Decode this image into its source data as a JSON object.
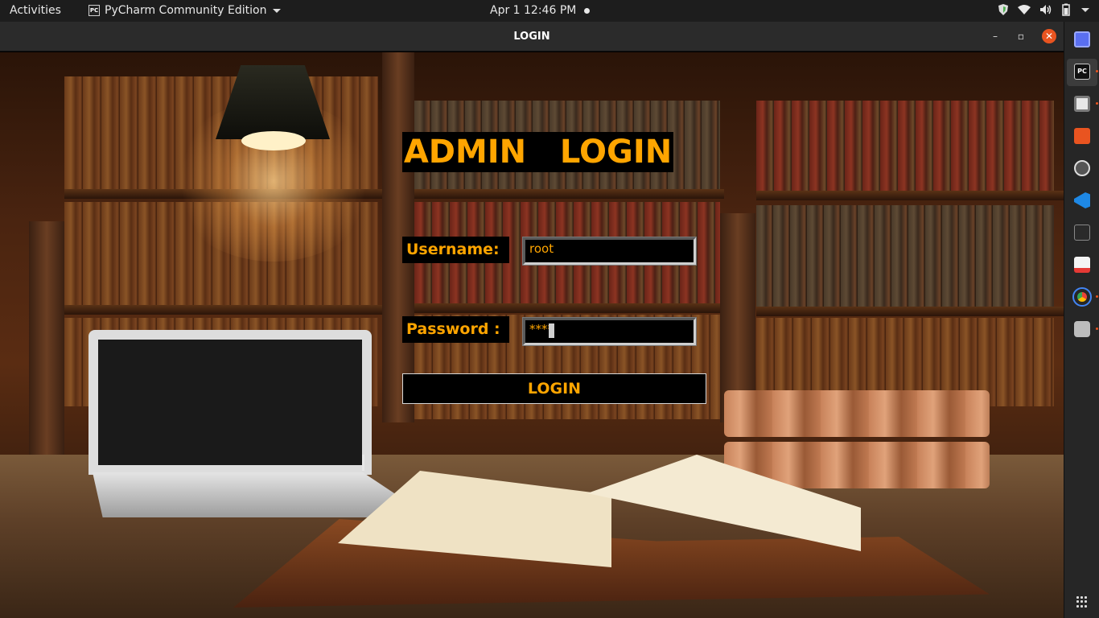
{
  "topbar": {
    "activities": "Activities",
    "app_name": "PyCharm Community Edition",
    "app_icon_text": "PC",
    "clock": "Apr 1  12:46 PM"
  },
  "window": {
    "title": "LOGIN",
    "minimize": "–",
    "maximize": "▫",
    "close": "✕"
  },
  "login": {
    "heading": "ADMIN   LOGIN",
    "username_label": "Username:",
    "username_value": "root",
    "password_label": "Password :",
    "password_value": "****",
    "button_label": "LOGIN"
  },
  "dock": {
    "icons": [
      "screenshot-icon",
      "pycharm-icon",
      "files-icon",
      "software-center-icon",
      "updater-icon",
      "vscode-icon",
      "terminal-icon",
      "document-viewer-icon",
      "chrome-icon",
      "disk-icon"
    ],
    "colors": {
      "accent": "#e95420",
      "label": "#ffa500"
    }
  }
}
